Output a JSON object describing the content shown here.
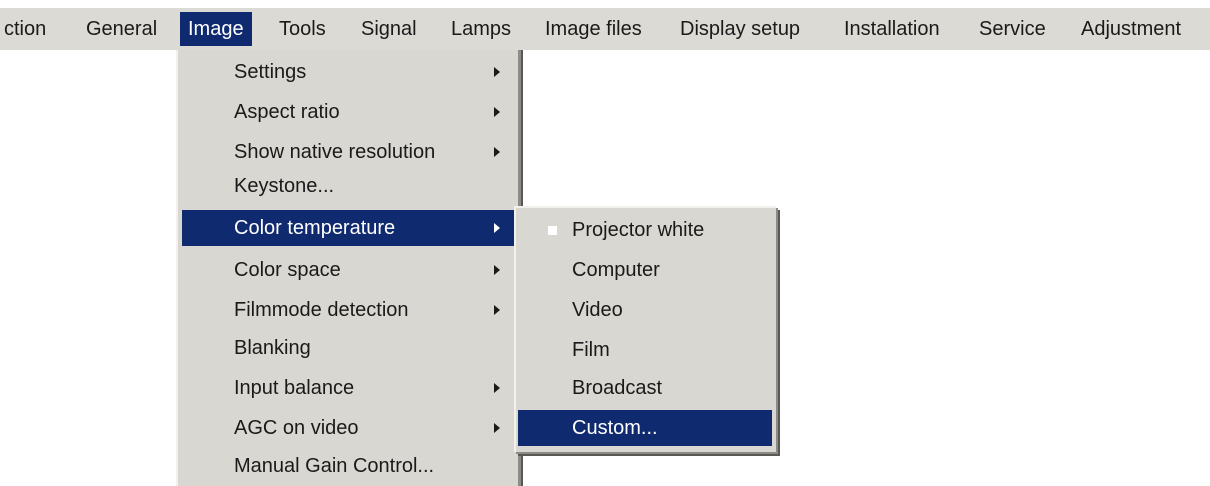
{
  "menubar": {
    "items": [
      "ction",
      "General",
      "Image",
      "Tools",
      "Signal",
      "Lamps",
      "Image files",
      "Display setup",
      "Installation",
      "Service",
      "Adjustment"
    ],
    "active": "Image"
  },
  "image_menu": {
    "items": [
      {
        "label": "Settings",
        "submenu": true
      },
      {
        "label": "Aspect ratio",
        "submenu": true
      },
      {
        "label": "Show native resolution",
        "submenu": true
      },
      {
        "label": "Keystone...",
        "submenu": false
      },
      {
        "label": "Color temperature",
        "submenu": true,
        "highlighted": true
      },
      {
        "label": "Color space",
        "submenu": true
      },
      {
        "label": "Filmmode detection",
        "submenu": true
      },
      {
        "label": "Blanking",
        "submenu": false
      },
      {
        "label": "Input balance",
        "submenu": true
      },
      {
        "label": "AGC on video",
        "submenu": true
      },
      {
        "label": "Manual Gain Control...",
        "submenu": false
      }
    ]
  },
  "color_temperature_menu": {
    "items": [
      {
        "label": "Projector white",
        "checked": true
      },
      {
        "label": "Computer"
      },
      {
        "label": "Video"
      },
      {
        "label": "Film"
      },
      {
        "label": "Broadcast"
      },
      {
        "label": "Custom...",
        "highlighted": true
      }
    ]
  },
  "colors": {
    "menu_background": "#d9d7d1",
    "highlight": "#0f2a6e",
    "highlight_text": "#ffffff"
  }
}
